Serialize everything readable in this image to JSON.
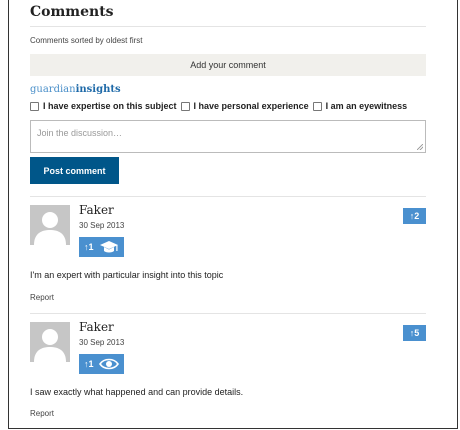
{
  "section": {
    "heading": "Comments",
    "sorted_text": "Comments sorted by oldest first",
    "add_comment_label": "Add your comment"
  },
  "brand": {
    "part1": "guardian",
    "part2": "insights"
  },
  "checkboxes": [
    {
      "label": "I have expertise on this subject",
      "checked": false
    },
    {
      "label": "I have personal experience",
      "checked": false
    },
    {
      "label": "I am an eyewitness",
      "checked": false
    }
  ],
  "composer": {
    "placeholder": "Join the discussion…",
    "post_label": "Post comment"
  },
  "comments": [
    {
      "author": "Faker",
      "date": "30 Sep 2013",
      "badge_count": "↑1",
      "badge_icon": "graduation-cap-icon",
      "vote": "↑2",
      "text": "I'm an expert with particular insight into this topic",
      "report": "Report"
    },
    {
      "author": "Faker",
      "date": "30 Sep 2013",
      "badge_count": "↑1",
      "badge_icon": "eye-icon",
      "vote": "↑5",
      "text": "I saw exactly what happened and can provide details.",
      "report": "Report"
    }
  ],
  "colors": {
    "accent": "#005689",
    "badge": "#4a90cf",
    "add_comment_bg": "#f1f0ec"
  }
}
